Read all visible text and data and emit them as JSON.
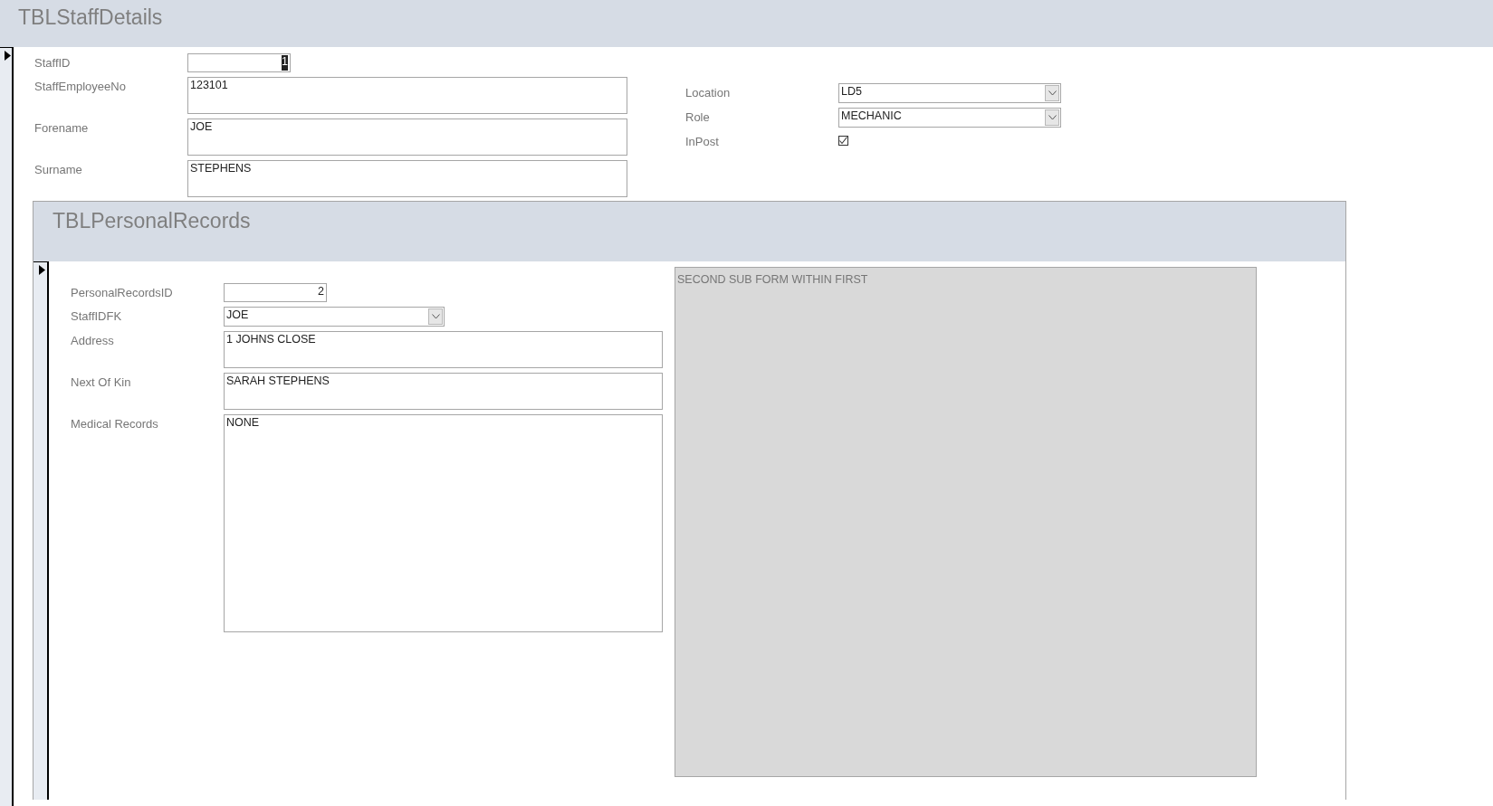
{
  "form": {
    "title": "TBLStaffDetails",
    "current_record": true
  },
  "left_fields": [
    {
      "kind": "number",
      "label": "StaffID",
      "value": "1",
      "highlighted": true
    },
    {
      "kind": "text",
      "label": "StaffEmployeeNo",
      "value": "123101"
    },
    {
      "kind": "text",
      "label": "Forename",
      "value": "JOE"
    },
    {
      "kind": "text",
      "label": "Surname",
      "value": "STEPHENS"
    }
  ],
  "right_fields": [
    {
      "kind": "combo",
      "label": "Location",
      "value": "LD5"
    },
    {
      "kind": "combo",
      "label": "Role",
      "value": "MECHANIC"
    },
    {
      "kind": "checkbox",
      "label": "InPost",
      "checked": true
    }
  ],
  "subform": {
    "title": "TBLPersonalRecords",
    "current_record": true,
    "fields": [
      {
        "kind": "number",
        "label": "PersonalRecordsID",
        "value": "2",
        "highlighted": false
      },
      {
        "kind": "combo",
        "label": "StaffIDFK",
        "value": "JOE"
      },
      {
        "kind": "text",
        "label": "Address",
        "value": "1 JOHNS CLOSE"
      },
      {
        "kind": "text",
        "label": "Next Of Kin",
        "value": "SARAH STEPHENS"
      },
      {
        "kind": "memo",
        "label": "Medical Records",
        "value": "NONE"
      }
    ],
    "nested_subform": {
      "label": "SECOND SUB FORM WITHIN FIRST"
    }
  }
}
